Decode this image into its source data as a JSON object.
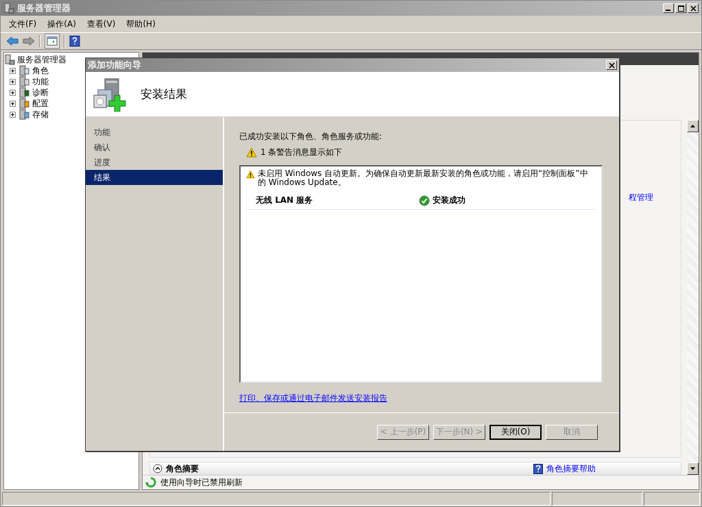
{
  "window": {
    "title": "服务器管理器"
  },
  "menu": [
    "文件(F)",
    "操作(A)",
    "查看(V)",
    "帮助(H)"
  ],
  "tree": {
    "root": "服务器管理器",
    "children": [
      {
        "label": "角色",
        "expanded": false
      },
      {
        "label": "功能",
        "expanded": false
      },
      {
        "label": "诊断",
        "expanded": false
      },
      {
        "label": "配置",
        "expanded": false
      },
      {
        "label": "存储",
        "expanded": false
      }
    ]
  },
  "right_pane": {
    "link": "程管理",
    "section": {
      "title": "角色摘要",
      "expanded": true,
      "help_link": "角色摘要帮助"
    },
    "notice": "使用向导时已禁用刷新"
  },
  "dialog": {
    "title": "添加功能向导",
    "heading": "安装结果",
    "steps": [
      {
        "label": "功能",
        "selected": false
      },
      {
        "label": "确认",
        "selected": false
      },
      {
        "label": "进度",
        "selected": false
      },
      {
        "label": "结果",
        "selected": true
      }
    ],
    "intro": "已成功安装以下角色、角色服务或功能:",
    "warning_summary": "1 条警告消息显示如下",
    "results": [
      {
        "kind": "warning",
        "text": "未启用 Windows 自动更新。为确保自动更新最新安装的角色或功能，请启用“控制面板”中的 Windows Update。"
      },
      {
        "kind": "item",
        "name": "无线 LAN 服务",
        "status": "安装成功"
      }
    ],
    "report_link": "打印、保存或通过电子邮件发送安装报告",
    "buttons": [
      {
        "label": "< 上一步(P)",
        "disabled": true,
        "default": false
      },
      {
        "label": "下一步(N) >",
        "disabled": true,
        "default": false
      },
      {
        "label": "关闭(O)",
        "disabled": false,
        "default": true
      },
      {
        "label": "取消",
        "disabled": true,
        "default": false
      }
    ]
  }
}
